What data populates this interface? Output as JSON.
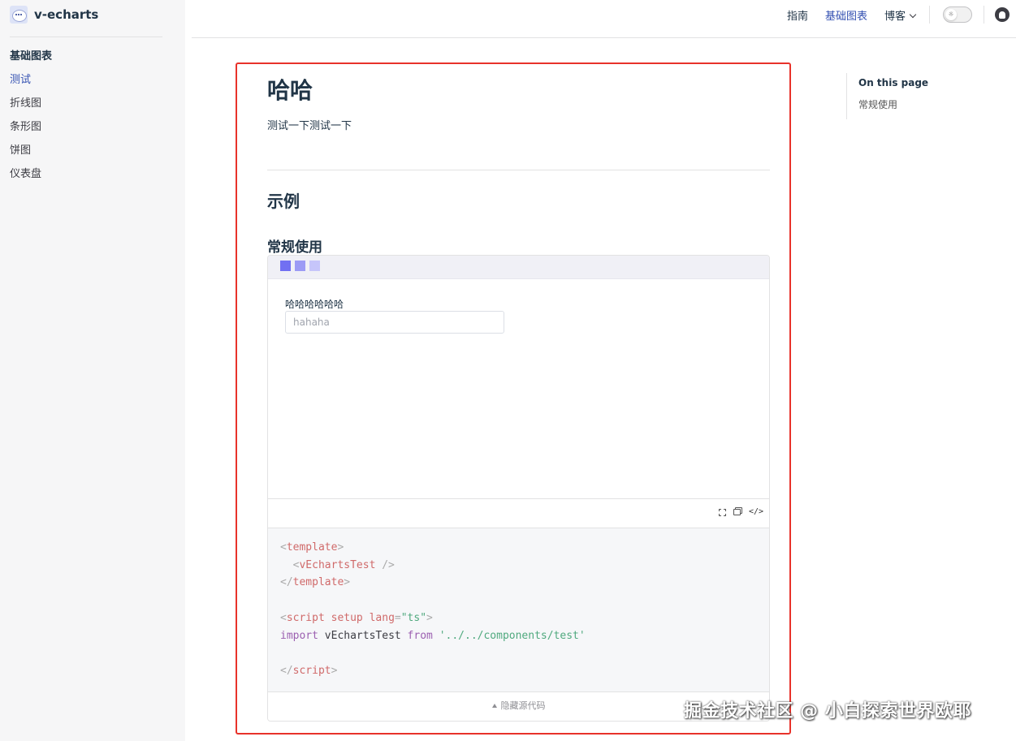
{
  "site": {
    "title": "v-echarts"
  },
  "sidebar": {
    "heading": "基础图表",
    "items": [
      {
        "label": "测试",
        "active": true
      },
      {
        "label": "折线图"
      },
      {
        "label": "条形图"
      },
      {
        "label": "饼图"
      },
      {
        "label": "仪表盘"
      }
    ]
  },
  "topnav": {
    "links": [
      {
        "label": "指南"
      },
      {
        "label": "基础图表",
        "active": true
      },
      {
        "label": "博客"
      }
    ],
    "theme_icon": "sun-icon",
    "github_icon": "github-icon"
  },
  "aside": {
    "title": "On this page",
    "links": [
      "常规使用"
    ]
  },
  "main": {
    "title": "哈哈",
    "intro": "测试一下测试一下",
    "section": "示例",
    "subsection": "常规使用",
    "demo": {
      "field_label": "哈哈哈哈哈哈",
      "field_placeholder": "hahaha",
      "footer_label": "隐藏源代码",
      "tools": [
        "fullscreen-icon",
        "copy-icon",
        "code-icon"
      ],
      "code_tool_label": "</>"
    }
  },
  "colors": {
    "accent": "#3451b2",
    "highlight_border": "#e8322a"
  },
  "watermark": "掘金技术社区 @ 小白探索世界欧耶"
}
